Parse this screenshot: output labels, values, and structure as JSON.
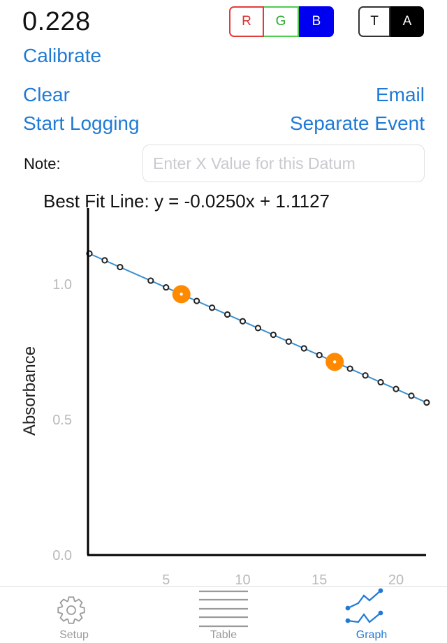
{
  "reading": {
    "value": "0.228"
  },
  "channel_selector": {
    "options": [
      {
        "label": "R",
        "selected": false,
        "color": "#d83030"
      },
      {
        "label": "G",
        "selected": false,
        "color": "#2eaa2e"
      },
      {
        "label": "B",
        "selected": true,
        "color": "#0000f0"
      }
    ]
  },
  "mode_selector": {
    "options": [
      {
        "label": "T",
        "selected": false
      },
      {
        "label": "A",
        "selected": true
      }
    ]
  },
  "actions": {
    "calibrate": "Calibrate",
    "clear": "Clear",
    "email": "Email",
    "start_logging": "Start Logging",
    "separate_event": "Separate Event"
  },
  "note": {
    "label": "Note:",
    "value": "",
    "placeholder": "Enter X Value for this Datum"
  },
  "best_fit_text": "Best Fit Line: y = -0.0250x + 1.1127",
  "chart_data": {
    "type": "scatter",
    "title": "Best Fit Line: y = -0.0250x + 1.1127",
    "xlabel": "",
    "ylabel": "Absorbance",
    "xlim": [
      0,
      22
    ],
    "ylim": [
      0,
      1.2
    ],
    "x_ticks": [
      5,
      10,
      15,
      20
    ],
    "x_tick_labels": [
      "5",
      "10",
      "15",
      "20"
    ],
    "y_ticks": [
      0.0,
      0.5,
      1.0
    ],
    "y_tick_labels": [
      "0.0",
      "0.5",
      "1.0"
    ],
    "grid": false,
    "fit_line": {
      "slope": -0.025,
      "intercept": 1.1127,
      "color": "#3a8fd0"
    },
    "series": [
      {
        "name": "readings",
        "marker": "hollow-circle",
        "color": "#222222",
        "x": [
          0,
          1,
          2,
          4,
          5,
          7,
          8,
          9,
          10,
          11,
          12,
          13,
          14,
          15,
          17,
          18,
          19,
          20,
          21,
          22
        ],
        "y": [
          1.113,
          1.088,
          1.063,
          1.013,
          0.988,
          0.938,
          0.913,
          0.888,
          0.863,
          0.838,
          0.813,
          0.788,
          0.763,
          0.738,
          0.688,
          0.663,
          0.638,
          0.613,
          0.588,
          0.563
        ]
      },
      {
        "name": "highlighted",
        "marker": "orange-dot",
        "color": "#ff8a00",
        "x": [
          6,
          16
        ],
        "y": [
          0.963,
          0.713
        ]
      }
    ]
  },
  "tabbar": {
    "tabs": [
      {
        "label": "Setup",
        "icon": "gear-icon",
        "active": false
      },
      {
        "label": "Table",
        "icon": "list-lines-icon",
        "active": false
      },
      {
        "label": "Graph",
        "icon": "graph-icon",
        "active": true
      }
    ],
    "active_color": "#1f7ad6",
    "inactive_color": "#9a9a9a"
  }
}
